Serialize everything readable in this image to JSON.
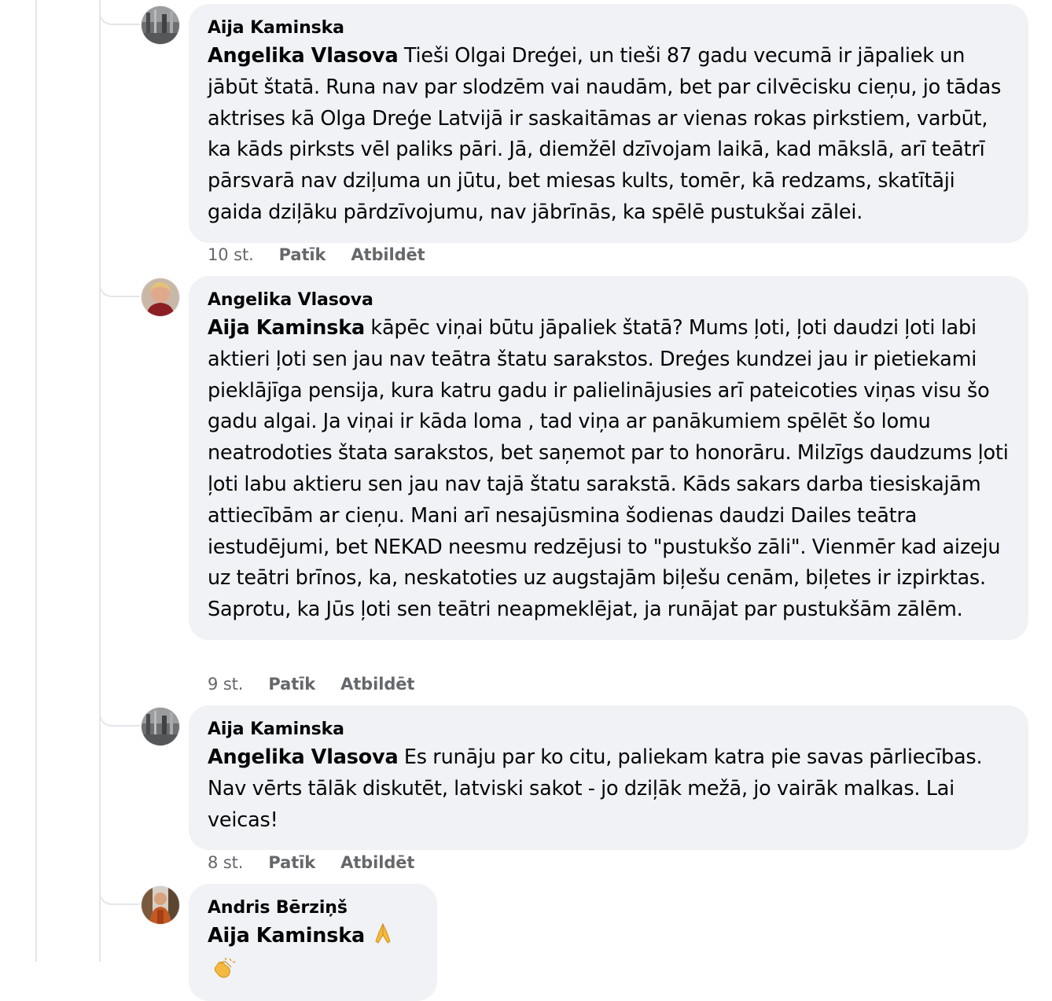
{
  "actions": {
    "like": "Patīk",
    "reply": "Atbildēt"
  },
  "comments": [
    {
      "author": "Aija Kaminska",
      "mention": "Angelika Vlasova",
      "text": " Tieši Olgai Dreģei, un tieši 87 gadu vecumā ir jāpaliek un jābūt štatā. Runa nav par slodzēm vai naudām, bet par cilvēcisku cieņu, jo tādas aktrises kā Olga Dreģe Latvijā ir saskaitāmas ar vienas rokas pirkstiem, varbūt, ka kāds pirksts vēl paliks pāri. Jā, diemžēl dzīvojam laikā, kad mākslā, arī teātrī pārsvarā nav dziļuma un jūtu, bet miesas kults, tomēr, kā redzams, skatītāji gaida dziļāku pārdzīvojumu, nav jābrīnās, ka spēlē pustukšai zālei.",
      "time": "10 st."
    },
    {
      "author": "Angelika Vlasova",
      "mention": "Aija Kaminska",
      "text": " kāpēc viņai būtu jāpaliek štatā? Mums ļoti, ļoti daudzi ļoti labi aktieri ļoti sen jau nav teātra štatu sarakstos. Dreģes kundzei jau ir pietiekami pieklājīga pensija, kura katru gadu ir palielinājusies arī pateicoties viņas visu šo gadu algai. Ja viņai ir kāda loma , tad viņa ar panākumiem spēlēt šo lomu neatrodoties štata sarakstos, bet saņemot par to honorāru. Milzīgs daudzums ļoti ļoti labu aktieru sen jau nav tajā štatu sarakstā. Kāds sakars darba tiesiskajām attiecībām ar cieņu. Mani arī nesajūsmina šodienas daudzi Dailes teātra iestudējumi, bet NEKAD neesmu redzējusi to \"pustukšo zāli\". Vienmēr kad aizeju uz teātri brīnos, ka, neskatoties uz augstajām biļešu cenām, biļetes ir izpirktas. Saprotu, ka Jūs ļoti sen teātri neapmeklējat, ja runājat par pustukšām zālēm.",
      "time": "9 st."
    },
    {
      "author": "Aija Kaminska",
      "mention": "Angelika Vlasova",
      "text": " Es runāju par ko citu, paliekam katra pie savas pārliecības. Nav vērts tālāk diskutēt, latviski sakot - jo dziļāk mežā, jo vairāk malkas. Lai veicas!",
      "time": "8 st."
    },
    {
      "author": "Andris Bērziņš",
      "mention": "Aija Kaminska",
      "text": "",
      "emojis": [
        "folded-hands-emoji",
        "clapping-hands-emoji"
      ]
    }
  ]
}
